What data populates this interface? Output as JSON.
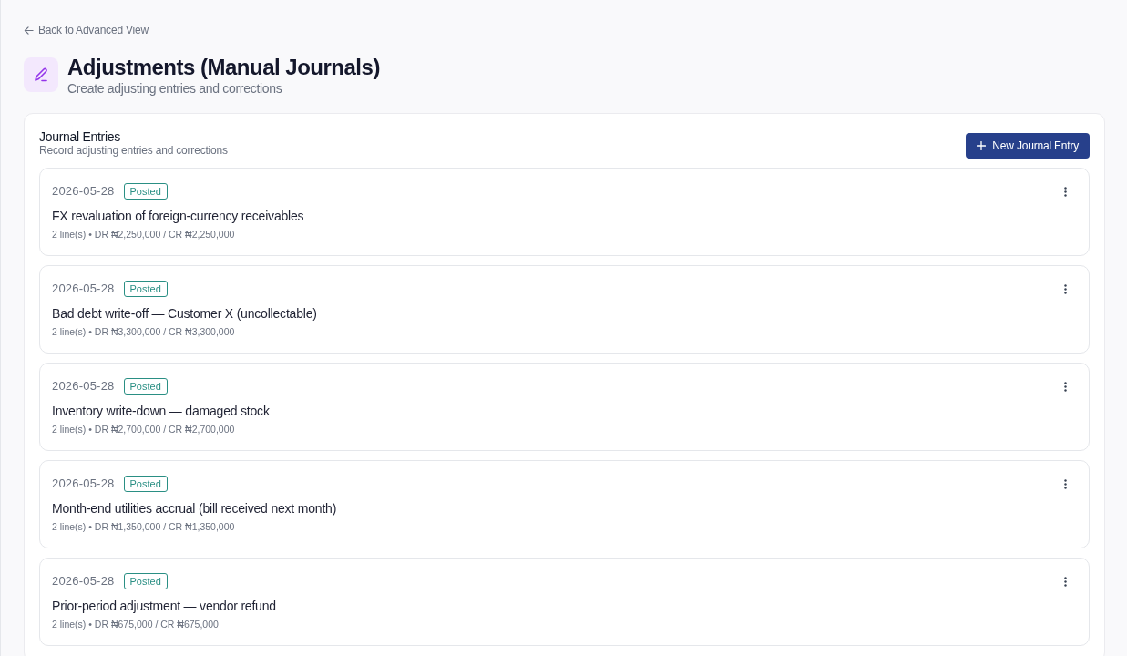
{
  "back_link": {
    "label": "Back to Advanced View"
  },
  "header": {
    "title": "Adjustments (Manual Journals)",
    "subtitle": "Create adjusting entries and corrections"
  },
  "panel": {
    "title": "Journal Entries",
    "subtitle": "Record adjusting entries and corrections",
    "new_button": {
      "label": "New Journal Entry"
    }
  },
  "entries": [
    {
      "date": "2026-05-28",
      "status": "Posted",
      "title": "FX revaluation of foreign-currency receivables",
      "summary": "2 line(s) • DR ₦2,250,000 / CR ₦2,250,000"
    },
    {
      "date": "2026-05-28",
      "status": "Posted",
      "title": "Bad debt write-off — Customer X (uncollectable)",
      "summary": "2 line(s) • DR ₦3,300,000 / CR ₦3,300,000"
    },
    {
      "date": "2026-05-28",
      "status": "Posted",
      "title": "Inventory write-down — damaged stock",
      "summary": "2 line(s) • DR ₦2,700,000 / CR ₦2,700,000"
    },
    {
      "date": "2026-05-28",
      "status": "Posted",
      "title": "Month-end utilities accrual (bill received next month)",
      "summary": "2 line(s) • DR ₦1,350,000 / CR ₦1,350,000"
    },
    {
      "date": "2026-05-28",
      "status": "Posted",
      "title": "Prior-period adjustment — vendor refund",
      "summary": "2 line(s) • DR ₦675,000 / CR ₦675,000"
    }
  ]
}
